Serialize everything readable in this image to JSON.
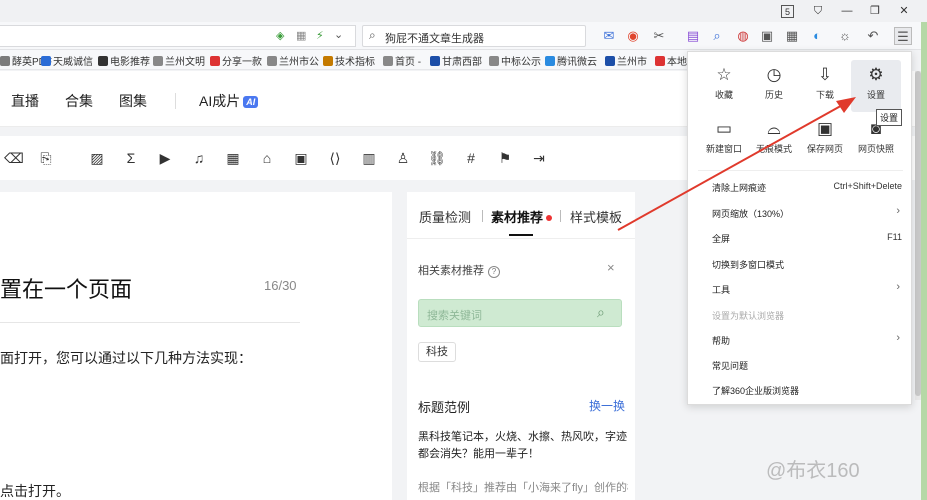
{
  "window": {
    "restore_glyph": "5",
    "shirt_glyph": "⛉",
    "min_glyph": "—",
    "max_glyph": "❐",
    "close_glyph": "✕"
  },
  "addressbar": {
    "search_text": "狗屁不通文章生成器"
  },
  "bookmarks": [
    {
      "label": "酵英PDF",
      "color": "#7b7b7b"
    },
    {
      "label": "天威诚信",
      "color": "#2b6cd6"
    },
    {
      "label": "电影推荐",
      "color": "#333333"
    },
    {
      "label": "兰州文明",
      "color": "#888888"
    },
    {
      "label": "分享一款",
      "color": "#d33"
    },
    {
      "label": "兰州市公",
      "color": "#888888"
    },
    {
      "label": "技术指标",
      "color": "#c47a00"
    },
    {
      "label": "首页 -",
      "color": "#888888"
    },
    {
      "label": "甘肃西部",
      "color": "#1d4fa8"
    },
    {
      "label": "中标公示",
      "color": "#888888"
    },
    {
      "label": "腾讯微云",
      "color": "#2a8be0"
    },
    {
      "label": "兰州市",
      "color": "#1d4fa8"
    },
    {
      "label": "本地",
      "color": "#d33"
    }
  ],
  "nav": {
    "items": [
      "直播",
      "合集",
      "图集"
    ],
    "ai_label": "AI成片",
    "ai_badge": "AI"
  },
  "editor": {
    "title": "置在一个页面",
    "count": "16/30",
    "para1": "面打开，您可以通过以下几种方法实现：",
    "para2": "点击打开。"
  },
  "panel": {
    "tabs": [
      "质量检测",
      "素材推荐",
      "样式模板"
    ],
    "header": "相关素材推荐",
    "help": "?",
    "close": "×",
    "search_placeholder": "搜索关键词",
    "tag": "科技",
    "section_title": "标题范例",
    "swap": "换一换",
    "example": "黑科技笔记本，火烧、水擦、热风吹，字迹都会消失？能用一辈子！",
    "note": "根据「科技」推荐由「小海来了fly」创作的标题"
  },
  "menu": {
    "tiles_row1": [
      {
        "icon": "☆",
        "label": "收藏"
      },
      {
        "icon": "◷",
        "label": "历史"
      },
      {
        "icon": "⇩",
        "label": "下载"
      },
      {
        "icon": "⚙",
        "label": "设置"
      }
    ],
    "tiles_row2": [
      {
        "icon": "▭",
        "label": "新建窗口"
      },
      {
        "icon": "⌓",
        "label": "无痕模式"
      },
      {
        "icon": "▣",
        "label": "保存网页"
      },
      {
        "icon": "◙",
        "label": "网页快照"
      }
    ],
    "tooltip": "设置",
    "items": [
      {
        "label": "清除上网痕迹",
        "shortcut": "Ctrl+Shift+Delete"
      },
      {
        "label": "网页缩放（130%）",
        "arrow": "›"
      },
      {
        "label": "全屏",
        "shortcut": "F11"
      },
      {
        "label": "切换到多窗口模式"
      },
      {
        "label": "工具",
        "arrow": "›"
      },
      {
        "label": "设置为默认浏览器"
      },
      {
        "label": "帮助",
        "arrow": "›"
      },
      {
        "label": "常见问题"
      },
      {
        "label": "了解360企业版浏览器"
      }
    ]
  },
  "watermark": "@布衣160",
  "colors": {
    "accent": "#3c6fd8",
    "arrow": "#e03a2c",
    "search_green": "#cfead2"
  }
}
